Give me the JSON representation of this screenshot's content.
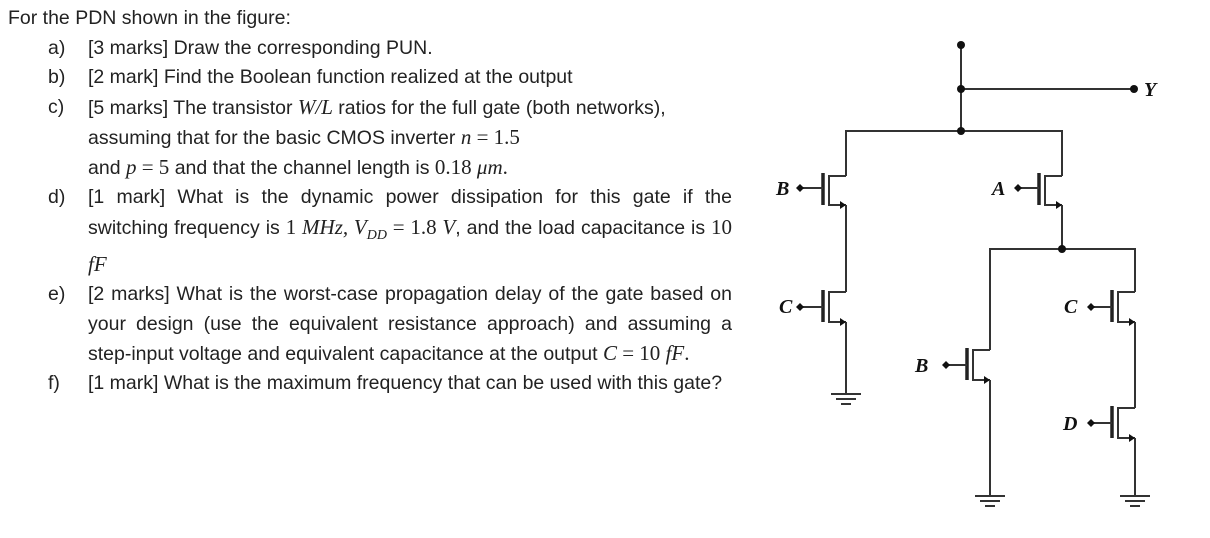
{
  "question": {
    "title": "For the PDN shown in the figure:",
    "items": [
      {
        "label": "a)",
        "parts": [
          "[3 marks] Draw the corresponding PUN."
        ]
      },
      {
        "label": "b)",
        "parts": [
          "[2 mark] Find the Boolean function realized at the output"
        ]
      },
      {
        "label": "c)",
        "parts": [
          "[5 marks] The transistor ",
          "W/L",
          " ratios for the full gate (both networks), assuming that for the basic CMOS inverter ",
          "n",
          " = 1.5",
          " and ",
          "p",
          " = 5",
          " and that the channel length is ",
          "0.18 ",
          "μm",
          "."
        ]
      },
      {
        "label": "d)",
        "parts": [
          "[1 mark] What is the dynamic power dissipation for this gate if the switching frequency is ",
          "1 ",
          "MHz, V",
          "DD",
          " = 1.8 ",
          "V",
          ", and the load capacitance is ",
          "10 ",
          "fF"
        ]
      },
      {
        "label": "e)",
        "parts": [
          "[2 marks] What is the worst-case propagation delay of the gate based on your design (use the equivalent resistance approach) and assuming a step-input voltage and equivalent capacitance at the output ",
          "C",
          " = 10 ",
          "fF",
          "."
        ]
      },
      {
        "label": "f)",
        "parts": [
          "[1 mark] What is the maximum frequency that can be used with this gate?"
        ]
      }
    ]
  },
  "circuit": {
    "type": "NMOS pull-down network",
    "output_label": "Y",
    "transistors": [
      {
        "gate": "B",
        "branch": "left-series-top"
      },
      {
        "gate": "C",
        "branch": "left-series-bottom"
      },
      {
        "gate": "A",
        "branch": "right-series-top"
      },
      {
        "gate": "B",
        "branch": "right-parallel-left"
      },
      {
        "gate": "C",
        "branch": "right-parallel-right-top"
      },
      {
        "gate": "D",
        "branch": "right-parallel-right-bottom"
      }
    ]
  }
}
